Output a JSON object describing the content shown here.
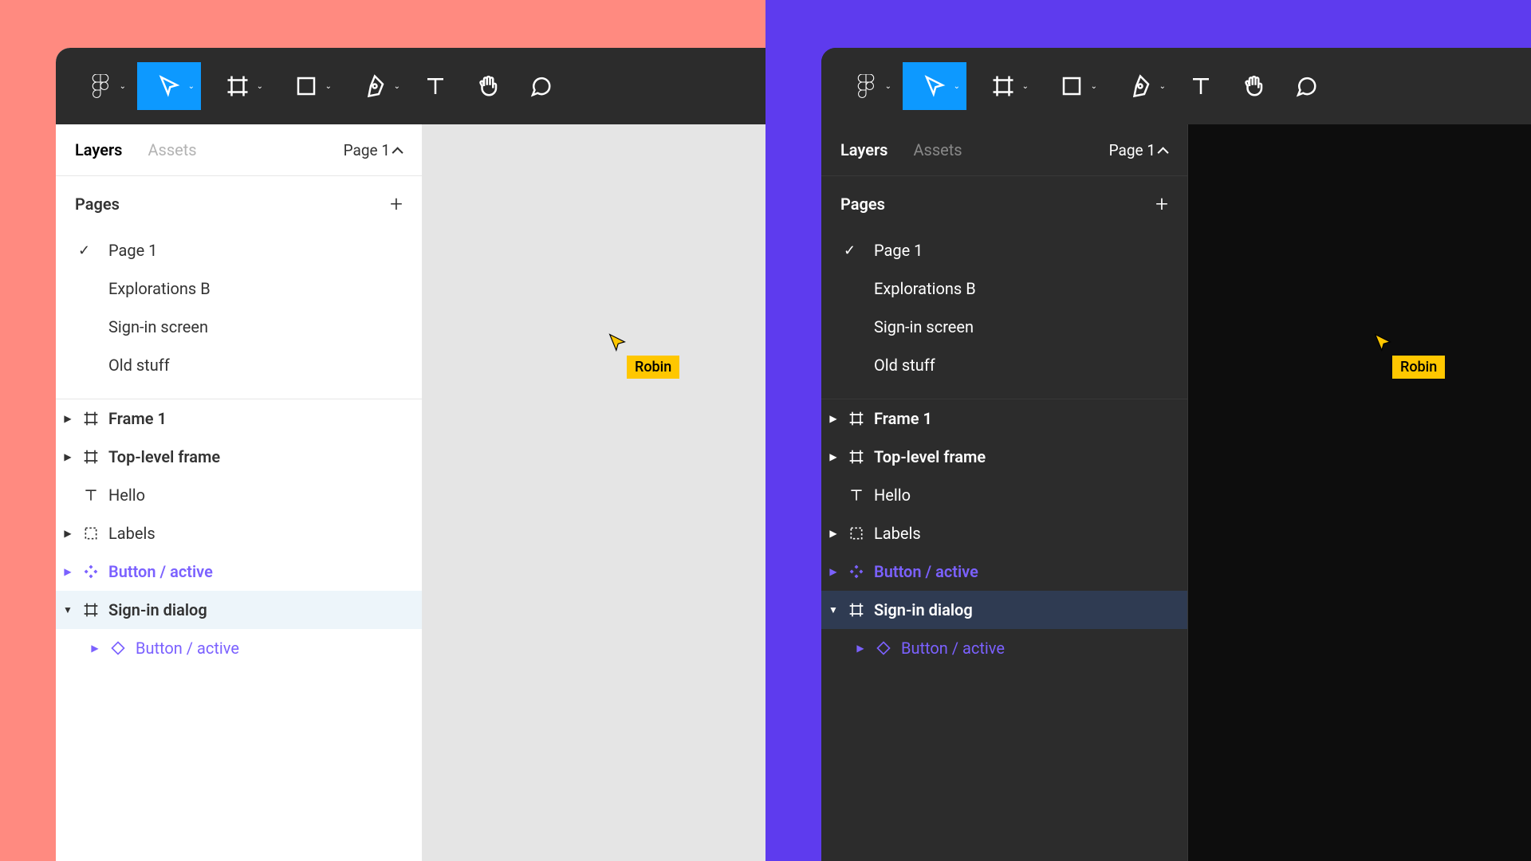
{
  "themes": [
    "light",
    "dark"
  ],
  "tabs": {
    "layers": "Layers",
    "assets": "Assets"
  },
  "page_switch": "Page 1",
  "pages_section": {
    "title": "Pages"
  },
  "pages": [
    {
      "label": "Page 1",
      "checked": true
    },
    {
      "label": "Explorations B",
      "checked": false
    },
    {
      "label": "Sign-in screen",
      "checked": false
    },
    {
      "label": "Old stuff",
      "checked": false
    }
  ],
  "layers": [
    {
      "label": "Frame 1",
      "icon": "frame",
      "arrow": true,
      "bold": true
    },
    {
      "label": "Top-level frame",
      "icon": "frame",
      "arrow": true,
      "bold": true
    },
    {
      "label": "Hello",
      "icon": "text",
      "arrow": false,
      "bold": false
    },
    {
      "label": "Labels",
      "icon": "group",
      "arrow": true,
      "bold": false
    },
    {
      "label": "Button / active",
      "icon": "component",
      "arrow": true,
      "bold": true,
      "purple": true
    },
    {
      "label": "Sign-in dialog",
      "icon": "frame",
      "arrow": true,
      "bold": true,
      "selected": true,
      "arrow_down": true
    },
    {
      "label": "Button / active",
      "icon": "instance",
      "arrow": true,
      "bold": false,
      "purple": true,
      "indent": true
    }
  ],
  "collaborator": {
    "name": "Robin",
    "color": "#FFC700"
  }
}
